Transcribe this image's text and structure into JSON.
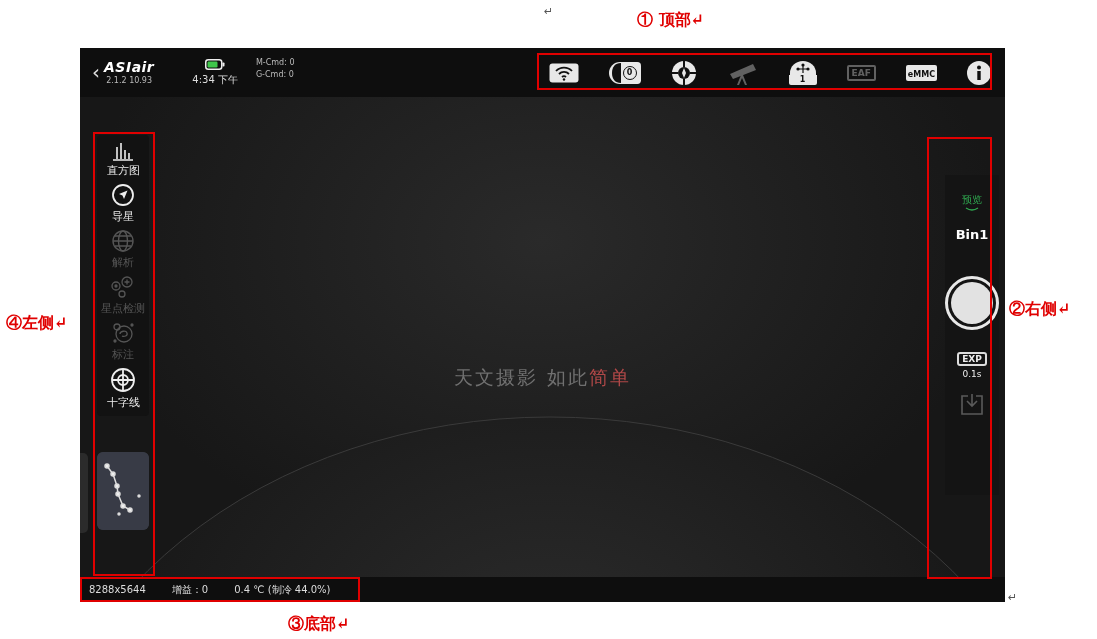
{
  "annotations": {
    "top": "①  顶部↵",
    "right": "②右侧↵",
    "bottom": "③底部↵",
    "left": "④左侧↵",
    "paragraph_marks": [
      "↵",
      "↵"
    ]
  },
  "header": {
    "back": "‹",
    "logo": "ASIair",
    "version": "2.1.2 10.93",
    "time": "4:34 下午",
    "m_cmd": "M-Cmd: 0",
    "g_cmd": "G-Cmd: 0"
  },
  "device_icons": [
    {
      "kind": "wifi",
      "disabled": false
    },
    {
      "kind": "focuser",
      "label": "0",
      "disabled": false
    },
    {
      "kind": "target",
      "disabled": false
    },
    {
      "kind": "telescope",
      "disabled": true
    },
    {
      "kind": "guider",
      "label": "1",
      "disabled": false
    },
    {
      "kind": "eaf",
      "label": "EAF",
      "disabled": true
    },
    {
      "kind": "emmc",
      "label": "eMMC",
      "disabled": false
    },
    {
      "kind": "info",
      "disabled": false
    }
  ],
  "sidebar": {
    "items": [
      {
        "kind": "histogram",
        "label": "直方图",
        "disabled": false
      },
      {
        "kind": "guide",
        "label": "导星",
        "disabled": false
      },
      {
        "kind": "solve",
        "label": "解析",
        "disabled": true
      },
      {
        "kind": "stars",
        "label": "星点检测",
        "disabled": true
      },
      {
        "kind": "annotate",
        "label": "标注",
        "disabled": true
      },
      {
        "kind": "crosshair",
        "label": "十字线",
        "disabled": false
      }
    ]
  },
  "slogan": {
    "text": "天文摄影 如此",
    "accent": "简单"
  },
  "right_panel": {
    "mode": "预览",
    "bin": "Bin1",
    "exposure_badge": "EXP",
    "exposure": "0.1s",
    "download": {
      "disabled": true
    }
  },
  "status_bar": {
    "resolution": "8288x5644",
    "gain": "增益：0",
    "temperature": "0.4 ℃ (制冷 44.0%)"
  }
}
